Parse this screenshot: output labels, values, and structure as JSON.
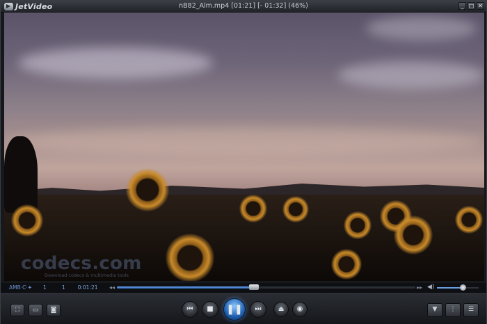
{
  "app": {
    "name": "JetVideo"
  },
  "window": {
    "title": "nB82_Alm.mp4 [01:21] [- 01:32] (46%)"
  },
  "window_buttons": [
    "_",
    "□",
    "✕"
  ],
  "video": {
    "watermark_text": "codecs.com",
    "watermark_subtext": "Download codecs & multimedia tools"
  },
  "seekbar": {
    "mode_label": "AMB·C·✦",
    "field1": "1",
    "field2": "1",
    "time": "0:01:21",
    "progress": 0.46,
    "volume": 0.62
  },
  "controls": {
    "left_icons": [
      "fullscreen-icon",
      "window-mode-icon",
      "snapshot-icon"
    ],
    "transport_icons": [
      "previous-icon",
      "stop-icon",
      "pause-icon",
      "next-icon"
    ],
    "extra_icons": [
      "open-folder-icon",
      "disc-icon"
    ],
    "right_icons": [
      "dropdown-menu-icon",
      "info-icon",
      "playlist-icon"
    ]
  },
  "colors": {
    "accent": "#4a90e2",
    "seek_fill": "#3f7dd0",
    "chrome_dark": "#16181c"
  }
}
